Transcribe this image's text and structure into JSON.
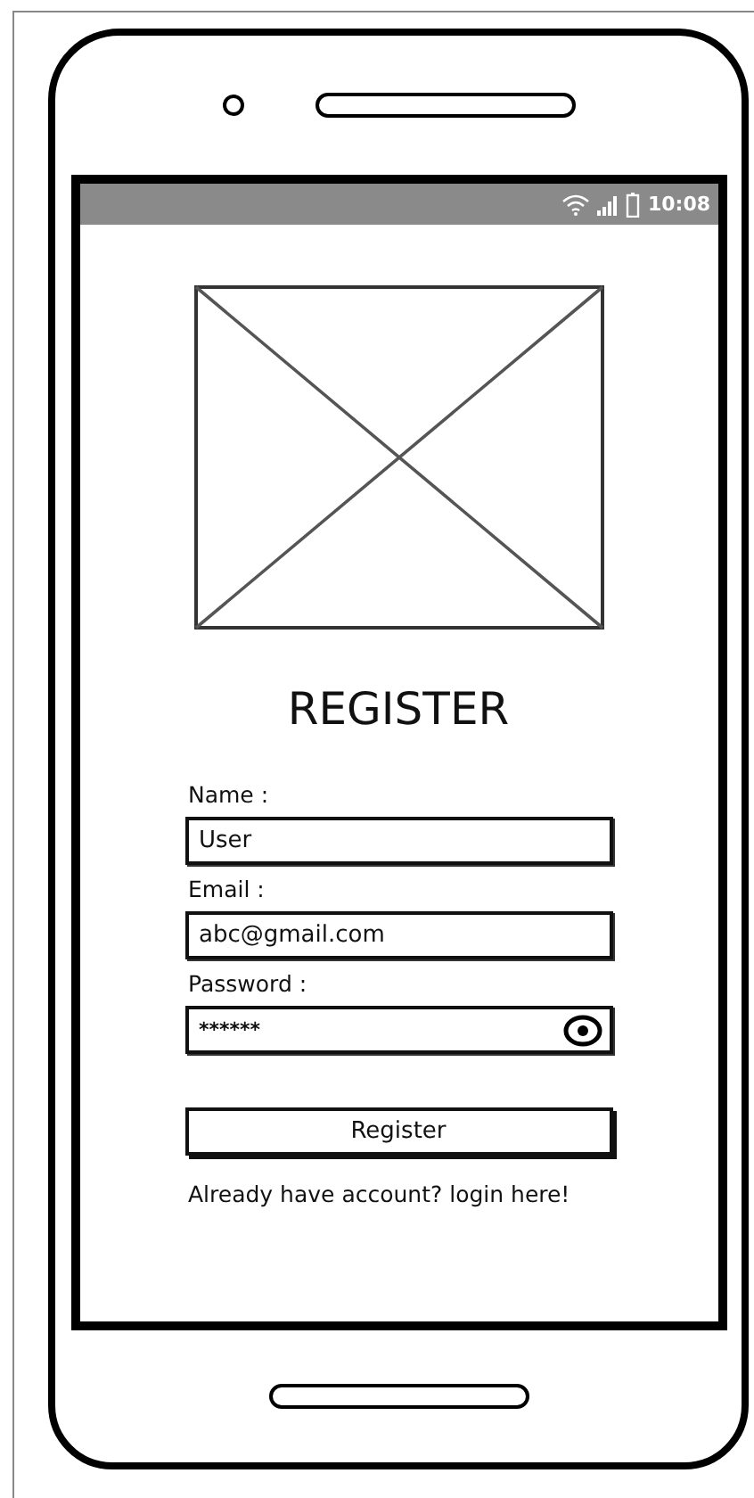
{
  "status_bar": {
    "time": "10:08"
  },
  "title": "REGISTER",
  "fields": [
    {
      "label": "Name :",
      "value": "User",
      "kind": "text"
    },
    {
      "label": "Email :",
      "value": "abc@gmail.com",
      "kind": "text"
    },
    {
      "label": "Password :",
      "value": "******",
      "kind": "password"
    }
  ],
  "submit_button": "Register",
  "footer_text": "Already have account? login here!"
}
